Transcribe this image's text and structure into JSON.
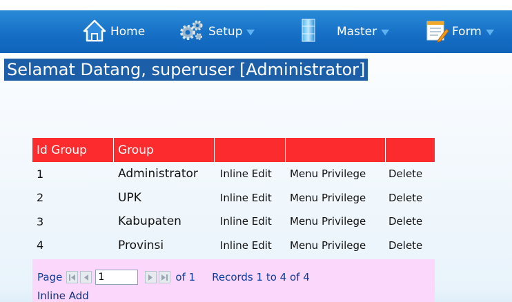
{
  "nav": {
    "items": [
      {
        "label": "Home",
        "icon": "home-icon"
      },
      {
        "label": "Setup",
        "icon": "gears-icon"
      },
      {
        "label": "Master",
        "icon": "database-icon"
      },
      {
        "label": "Form",
        "icon": "form-edit-icon"
      }
    ],
    "bar_color": "#1670c6"
  },
  "welcome": "Selamat Datang, superuser [Administrator]",
  "table": {
    "header_color": "#fc2b2d",
    "columns": [
      "Id Group",
      "Group",
      "",
      "",
      ""
    ],
    "rows": [
      {
        "id": "1",
        "group": "Administrator",
        "edit": "Inline Edit",
        "privilege": "Menu Privilege",
        "delete": "Delete"
      },
      {
        "id": "2",
        "group": "UPK",
        "edit": "Inline Edit",
        "privilege": "Menu Privilege",
        "delete": "Delete"
      },
      {
        "id": "3",
        "group": "Kabupaten",
        "edit": "Inline Edit",
        "privilege": "Menu Privilege",
        "delete": "Delete"
      },
      {
        "id": "4",
        "group": "Provinsi",
        "edit": "Inline Edit",
        "privilege": "Menu Privilege",
        "delete": "Delete"
      }
    ]
  },
  "pager": {
    "page_label": "Page",
    "page_value": "1",
    "of_label": "of 1",
    "records_label": "Records 1 to 4 of 4",
    "inline_add": "Inline Add",
    "background": "#fcd7fc"
  }
}
